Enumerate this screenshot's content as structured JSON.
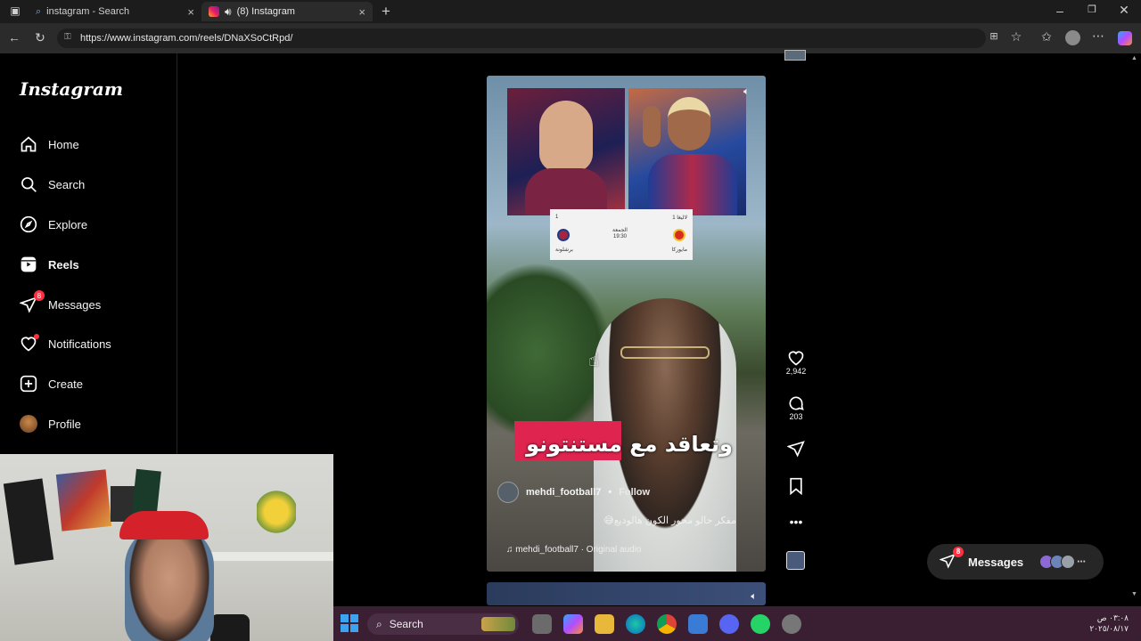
{
  "browser": {
    "tabs": [
      {
        "title": "instagram - Search",
        "active": false
      },
      {
        "title": "(8) Instagram",
        "active": true
      }
    ],
    "url": "https://www.instagram.com/reels/DNaXSoCtRpd/"
  },
  "sidebar": {
    "logo": "Instagram",
    "items": [
      {
        "label": "Home",
        "icon": "home-icon"
      },
      {
        "label": "Search",
        "icon": "search-icon"
      },
      {
        "label": "Explore",
        "icon": "compass-icon"
      },
      {
        "label": "Reels",
        "icon": "reels-icon",
        "active": true
      },
      {
        "label": "Messages",
        "icon": "messenger-icon",
        "badge": "8"
      },
      {
        "label": "Notifications",
        "icon": "heart-icon",
        "dot": true
      },
      {
        "label": "Create",
        "icon": "plus-square-icon"
      },
      {
        "label": "Profile",
        "icon": "avatar"
      }
    ]
  },
  "reel": {
    "caption_overlay": "وتعاقد مع مستنتونو",
    "author": "mehdi_football7",
    "follow": "Follow",
    "separator": "•",
    "description": "مفكر حالو محور الكون هالوديع😅",
    "audio": "mehdi_football7 · Original audio",
    "scorecard": {
      "time": "19:30",
      "label_top": "الجمعة",
      "home": "برشلونة",
      "away": "مايوركا",
      "left_label": "1",
      "right_label": "1 لاليغا"
    }
  },
  "actions": {
    "likes": "2,942",
    "comments": "203"
  },
  "messages_pill": {
    "label": "Messages",
    "badge": "8"
  },
  "taskbar": {
    "search": "Search",
    "time": "٠٣:٠٨ ص",
    "date": "٢٠٢٥/٠٨/١٧"
  },
  "colors": {
    "accent_red": "#ff3040",
    "caption_highlight": "#e02450",
    "taskbar": "#3a1f33"
  }
}
